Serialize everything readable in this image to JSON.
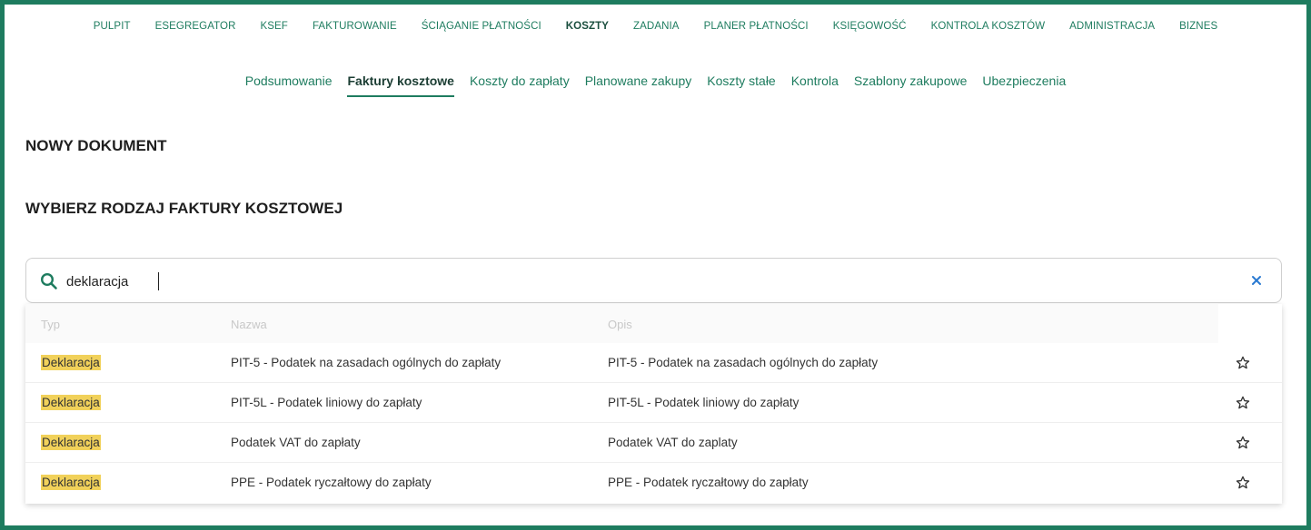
{
  "colors": {
    "brand": "#1e7c5f",
    "highlight": "#f1d15a",
    "border": "#cfcfcf"
  },
  "top_nav": {
    "items": [
      {
        "label": "PULPIT",
        "active": false
      },
      {
        "label": "ESEGREGATOR",
        "active": false
      },
      {
        "label": "KSEF",
        "active": false
      },
      {
        "label": "FAKTUROWANIE",
        "active": false
      },
      {
        "label": "ŚCIĄGANIE PŁATNOŚCI",
        "active": false
      },
      {
        "label": "KOSZTY",
        "active": true
      },
      {
        "label": "ZADANIA",
        "active": false
      },
      {
        "label": "PLANER PŁATNOŚCI",
        "active": false
      },
      {
        "label": "KSIĘGOWOŚĆ",
        "active": false
      },
      {
        "label": "KONTROLA KOSZTÓW",
        "active": false
      },
      {
        "label": "ADMINISTRACJA",
        "active": false
      },
      {
        "label": "BIZNES",
        "active": false
      }
    ]
  },
  "sub_nav": {
    "items": [
      {
        "label": "Podsumowanie",
        "active": false
      },
      {
        "label": "Faktury kosztowe",
        "active": true
      },
      {
        "label": "Koszty do zapłaty",
        "active": false
      },
      {
        "label": "Planowane zakupy",
        "active": false
      },
      {
        "label": "Koszty stałe",
        "active": false
      },
      {
        "label": "Kontrola",
        "active": false
      },
      {
        "label": "Szablony zakupowe",
        "active": false
      },
      {
        "label": "Ubezpieczenia",
        "active": false
      }
    ]
  },
  "page": {
    "title": "NOWY DOKUMENT",
    "subtitle": "WYBIERZ RODZAJ FAKTURY KOSZTOWEJ"
  },
  "search": {
    "value": "deklaracja",
    "icon": "search-icon",
    "clear_icon": "close-icon"
  },
  "results": {
    "columns": {
      "typ": "Typ",
      "nazwa": "Nazwa",
      "opis": "Opis"
    },
    "rows": [
      {
        "typ": "Deklaracja",
        "nazwa": "PIT-5 - Podatek na zasadach ogólnych do zapłaty",
        "opis": "PIT-5 - Podatek na zasadach ogólnych do zapłaty"
      },
      {
        "typ": "Deklaracja",
        "nazwa": "PIT-5L - Podatek liniowy do zapłaty",
        "opis": "PIT-5L - Podatek liniowy do zapłaty"
      },
      {
        "typ": "Deklaracja",
        "nazwa": "Podatek VAT do zapłaty",
        "opis": "Podatek VAT do zaplaty"
      },
      {
        "typ": "Deklaracja",
        "nazwa": "PPE - Podatek ryczałtowy do zapłaty",
        "opis": "PPE - Podatek ryczałtowy do zapłaty"
      }
    ]
  }
}
